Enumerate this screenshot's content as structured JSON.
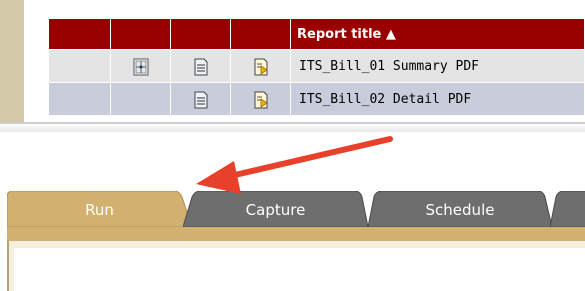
{
  "report_table": {
    "header_title": "Report title ▲",
    "rows": [
      {
        "name": "ITS_Bill_01 Summary PDF"
      },
      {
        "name": "ITS_Bill_02 Detail PDF"
      }
    ]
  },
  "tabs": [
    {
      "label": "Run",
      "active": true
    },
    {
      "label": "Capture",
      "active": false
    },
    {
      "label": "Schedule",
      "active": false
    }
  ],
  "colors": {
    "header_bg": "#990000",
    "active_tab": "#d2b070",
    "inactive_tab": "#6e6e6e",
    "arrow": "#e8402a"
  }
}
